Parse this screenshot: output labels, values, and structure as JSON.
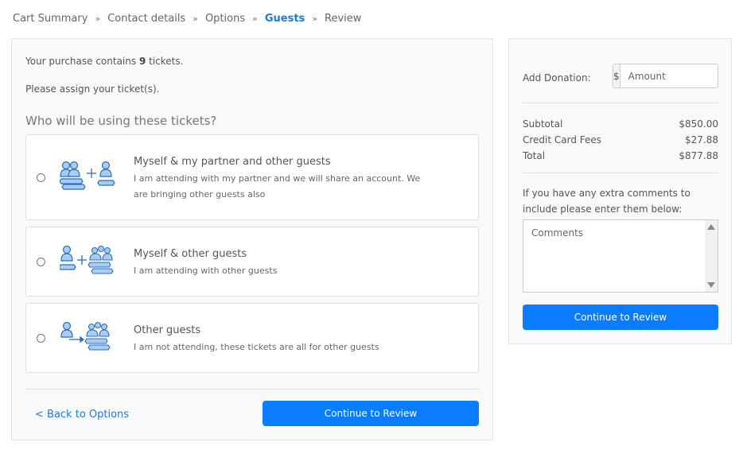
{
  "breadcrumb": {
    "items": [
      "Cart Summary",
      "Contact details",
      "Options",
      "Guests",
      "Review"
    ],
    "active": "Guests",
    "separator": "»"
  },
  "main": {
    "purchase_prefix": "Your purchase contains ",
    "ticket_count": "9",
    "purchase_suffix": " tickets.",
    "assign_text": "Please assign your ticket(s).",
    "question": "Who will be using these tickets?",
    "options": [
      {
        "title": "Myself & my partner and other guests",
        "description": "I am attending with my partner and we will share an account. We are bringing other guests also",
        "icon": "partner-and-guests-icon"
      },
      {
        "title": "Myself & other guests",
        "description": "I am attending with other guests",
        "icon": "self-and-guests-icon"
      },
      {
        "title": "Other guests",
        "description": "I am not attending, these tickets are all for other guests",
        "icon": "other-guests-icon"
      }
    ],
    "back_label": "< Back to Options",
    "continue_label": "Continue to Review"
  },
  "sidebar": {
    "donation_label": "Add Donation:",
    "currency_prefix": "$",
    "amount_placeholder": "Amount",
    "rows": [
      {
        "label": "Subtotal",
        "value": "$850.00"
      },
      {
        "label": "Credit Card Fees",
        "value": "$27.88"
      },
      {
        "label": "Total",
        "value": "$877.88"
      }
    ],
    "comments_label": "If you have any extra comments to include please enter them below:",
    "comments_placeholder": "Comments",
    "continue_label": "Continue to Review"
  },
  "colors": {
    "accent": "#0a7cff",
    "link": "#1e7bd6",
    "icon_fill": "#a9cdf2",
    "icon_stroke": "#2a6fb8"
  }
}
